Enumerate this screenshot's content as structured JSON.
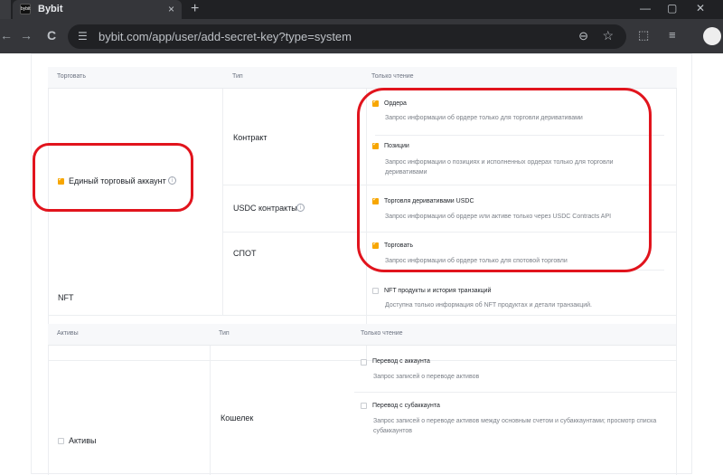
{
  "browser": {
    "tab_favicon": "bybit",
    "tab_title": "Bybit",
    "tab_close": "×",
    "new_tab": "+",
    "url": "bybit.com/app/user/add-secret-key?type=system",
    "win_min": "—",
    "win_max": "▢",
    "back": "←",
    "forward": "→",
    "reload": "C"
  },
  "trade_header": {
    "col1": "Торговать",
    "col2": "Тип",
    "col3": "Только чтение"
  },
  "unified_account": {
    "label": "Единый торговый аккаунт",
    "checked": true
  },
  "contract_label": "Контракт",
  "usdc_label": "USDC контракты",
  "spot_label": "СПОТ",
  "nft_label": "NFT",
  "permissions": [
    {
      "label": "Ордера",
      "desc": "Запрос информации об ордере только для торговли деривативами",
      "checked": true
    },
    {
      "label": "Позиции",
      "desc": "Запрос информации о позициях и исполненных ордерах только для торговли деривативами",
      "checked": true
    },
    {
      "label": "Торговля деривативами USDC",
      "desc": "Запрос информации об ордере или активе только через USDC Contracts API",
      "checked": true
    },
    {
      "label": "Торговать",
      "desc": "Запрос информации об ордере только для спотовой торговли",
      "checked": true
    },
    {
      "label": "NFT продукты и история транзакций",
      "desc": "Доступна только информация об NFT продуктах и детали транзакций.",
      "checked": false
    }
  ],
  "assets_header": {
    "col1": "Активы",
    "col2": "Тип",
    "col3": "Только чтение"
  },
  "assets_label": "Активы",
  "wallet_label": "Кошелек",
  "asset_permissions": [
    {
      "label": "Перевод с аккаунта",
      "desc": "Запрос записей о переводе активов",
      "checked": false
    },
    {
      "label": "Перевод с субаккаунта",
      "desc": "Запрос записей о переводе активов между основным счетом и субаккаунтами; просмотр списка субаккаунтов",
      "checked": false
    }
  ],
  "colors": {
    "accent": "#f7a600",
    "highlight": "#e1141d"
  }
}
